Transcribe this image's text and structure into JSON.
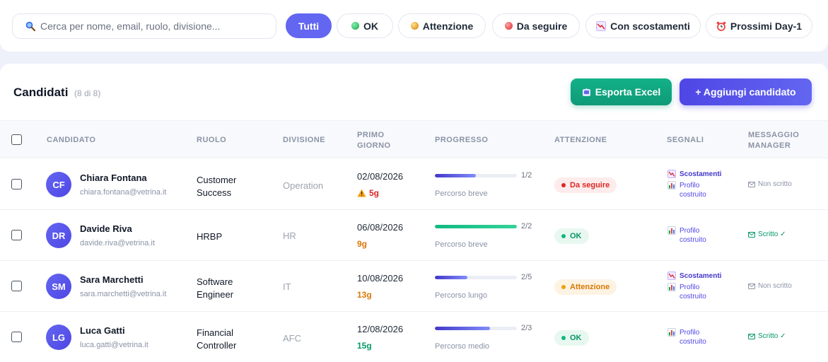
{
  "search": {
    "placeholder": "Cerca per nome, email, ruolo, divisione..."
  },
  "filters": [
    {
      "label": "Tutti",
      "active": true
    },
    {
      "label": "OK",
      "icon": "green-dot-icon"
    },
    {
      "label": "Attenzione",
      "icon": "yellow-dot-icon"
    },
    {
      "label": "Da seguire",
      "icon": "red-dot-icon"
    },
    {
      "label": "Con scostamenti",
      "icon": "chart-down-icon"
    },
    {
      "label": "Prossimi Day-1",
      "icon": "alarm-clock-icon"
    }
  ],
  "list": {
    "title": "Candidati",
    "count": "(8 di 8)",
    "export_label": "Esporta Excel",
    "add_label": "+ Aggiungi candidato"
  },
  "columns": {
    "candidato": "CANDIDATO",
    "ruolo": "RUOLO",
    "divisione": "DIVISIONE",
    "primo_giorno_1": "PRIMO",
    "primo_giorno_2": "GIORNO",
    "progresso": "PROGRESSO",
    "attenzione": "ATTENZIONE",
    "segnali": "SEGNALI",
    "messaggio_1": "MESSAGGIO",
    "messaggio_2": "MANAGER"
  },
  "rows": [
    {
      "initials": "CF",
      "name": "Chiara Fontana",
      "email": "chiara.fontana@vetrina.it",
      "role": "Customer Success",
      "division": "Operation",
      "date": "02/08/2026",
      "days": "5g",
      "days_status": "red",
      "days_warning": true,
      "progress": 0.5,
      "progress_count": "1/2",
      "progress_label": "Percorso breve",
      "attention": "Da seguire",
      "attention_status": "red",
      "signals": [
        "Scostamenti",
        "Profilo costruito"
      ],
      "message": "Non scritto",
      "message_status": "grey"
    },
    {
      "initials": "DR",
      "name": "Davide Riva",
      "email": "davide.riva@vetrina.it",
      "role": "HRBP",
      "division": "HR",
      "date": "06/08/2026",
      "days": "9g",
      "days_status": "orange",
      "days_warning": false,
      "progress": 1.0,
      "progress_count": "2/2",
      "progress_label": "Percorso breve",
      "attention": "OK",
      "attention_status": "green",
      "signals": [
        "Profilo costruito"
      ],
      "message": "Scritto ✓",
      "message_status": "green"
    },
    {
      "initials": "SM",
      "name": "Sara Marchetti",
      "email": "sara.marchetti@vetrina.it",
      "role": "Software Engineer",
      "division": "IT",
      "date": "10/08/2026",
      "days": "13g",
      "days_status": "orange",
      "days_warning": false,
      "progress": 0.4,
      "progress_count": "2/5",
      "progress_label": "Percorso lungo",
      "attention": "Attenzione",
      "attention_status": "orange",
      "signals": [
        "Scostamenti",
        "Profilo costruito"
      ],
      "message": "Non scritto",
      "message_status": "grey"
    },
    {
      "initials": "LG",
      "name": "Luca Gatti",
      "email": "luca.gatti@vetrina.it",
      "role": "Financial Controller",
      "division": "AFC",
      "date": "12/08/2026",
      "days": "15g",
      "days_status": "green",
      "days_warning": false,
      "progress": 0.67,
      "progress_count": "2/3",
      "progress_label": "Percorso medio",
      "attention": "OK",
      "attention_status": "green",
      "signals": [
        "Profilo costruito"
      ],
      "message": "Scritto ✓",
      "message_status": "green"
    }
  ]
}
